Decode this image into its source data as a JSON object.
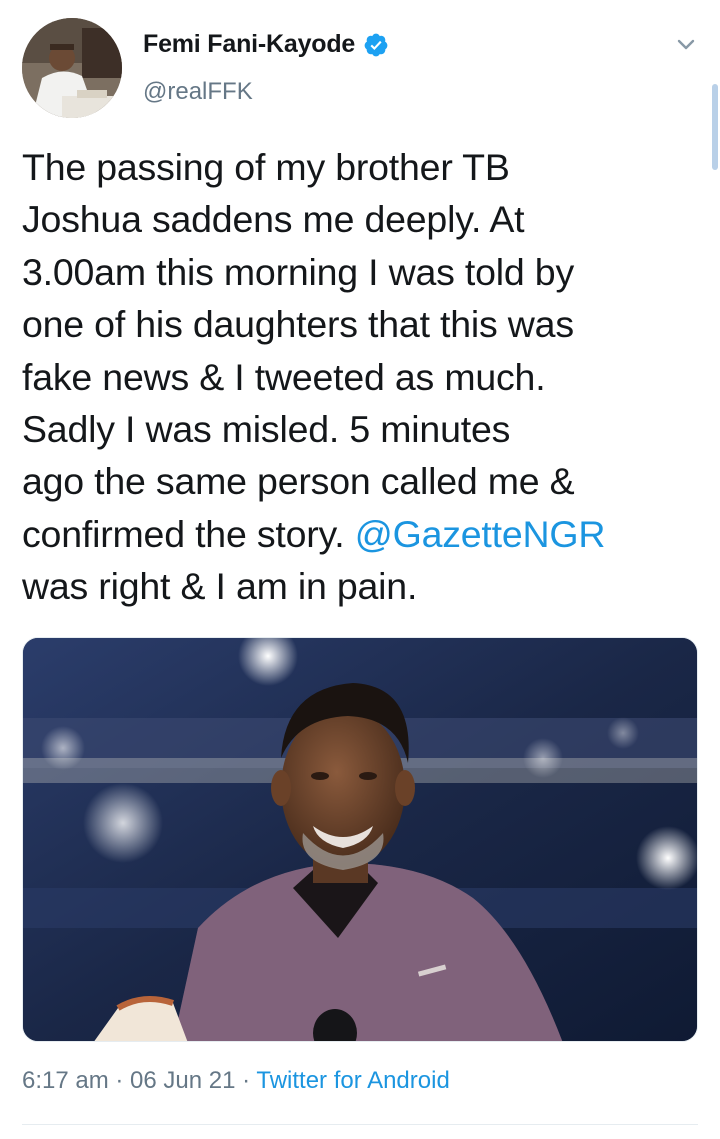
{
  "author": {
    "name": "Femi Fani-Kayode",
    "handle": "@realFFK",
    "verified": true
  },
  "tweet": {
    "text_before_mention": "The passing of my brother TB\nJoshua saddens me deeply. At\n3.00am this morning I was told by\none of his daughters that this was\nfake news & I tweeted as much.\nSadly I was misled. 5 minutes\nago the same person called me &\nconfirmed the story. ",
    "mention": "@GazetteNGR",
    "text_after_mention": "\nwas right & I am in pain."
  },
  "media": {
    "description_icon": "photo"
  },
  "footer": {
    "time": "6:17 am",
    "separator1": " · ",
    "date": "06 Jun 21",
    "separator2": " · ",
    "source": "Twitter for Android"
  },
  "colors": {
    "link": "#1b95e0",
    "secondary": "#657786",
    "text": "#14171a"
  },
  "icons": {
    "verified": "verified-badge-icon",
    "menu": "chevron-down-icon"
  }
}
